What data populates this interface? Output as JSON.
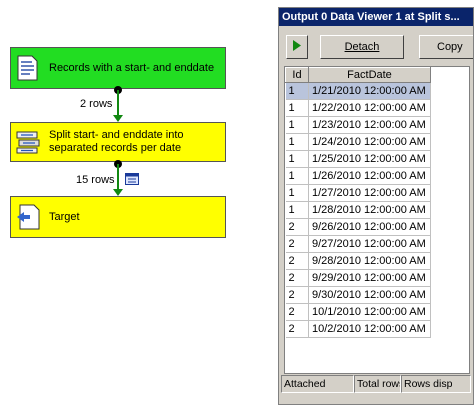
{
  "canvas": {
    "tasks": [
      {
        "label": "Records with  a start- and enddate"
      },
      {
        "label": "Split start- and enddate into separated records per date"
      },
      {
        "label": "Target"
      }
    ],
    "paths": [
      {
        "label": "2 rows"
      },
      {
        "label": "15 rows"
      }
    ]
  },
  "viewer": {
    "title": "Output 0 Data Viewer 1 at Split s...",
    "detach_label": "Detach",
    "copy_label": "Copy",
    "columns": [
      "Id",
      "FactDate"
    ],
    "rows": [
      [
        "1",
        "1/21/2010 12:00:00 AM"
      ],
      [
        "1",
        "1/22/2010 12:00:00 AM"
      ],
      [
        "1",
        "1/23/2010 12:00:00 AM"
      ],
      [
        "1",
        "1/24/2010 12:00:00 AM"
      ],
      [
        "1",
        "1/25/2010 12:00:00 AM"
      ],
      [
        "1",
        "1/26/2010 12:00:00 AM"
      ],
      [
        "1",
        "1/27/2010 12:00:00 AM"
      ],
      [
        "1",
        "1/28/2010 12:00:00 AM"
      ],
      [
        "2",
        "9/26/2010 12:00:00 AM"
      ],
      [
        "2",
        "9/27/2010 12:00:00 AM"
      ],
      [
        "2",
        "9/28/2010 12:00:00 AM"
      ],
      [
        "2",
        "9/29/2010 12:00:00 AM"
      ],
      [
        "2",
        "9/30/2010 12:00:00 AM"
      ],
      [
        "2",
        "10/1/2010 12:00:00 AM"
      ],
      [
        "2",
        "10/2/2010 12:00:00 AM"
      ]
    ],
    "status": {
      "attached": "Attached",
      "total": "Total rows",
      "displayed": "Rows disp"
    }
  },
  "colors": {
    "source_task": "#22dd22",
    "transform_task": "#ffff00",
    "path_line": "#118811",
    "title_bar": "#0a246a",
    "selected_row": "#b9c4dc"
  }
}
